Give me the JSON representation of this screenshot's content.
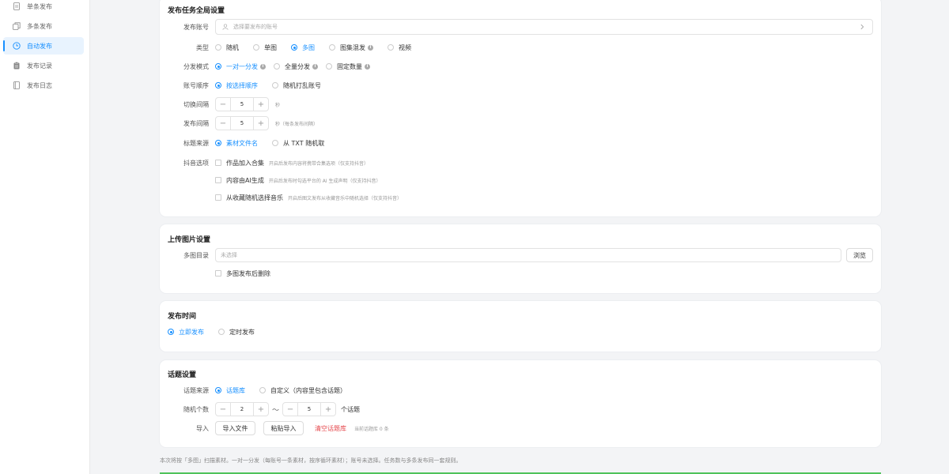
{
  "sidebar": {
    "items": [
      {
        "label": "单条发布",
        "icon": "document-icon"
      },
      {
        "label": "多条发布",
        "icon": "copy-icon"
      },
      {
        "label": "自动发布",
        "icon": "clock-icon",
        "active": true
      },
      {
        "label": "发布记录",
        "icon": "clipboard-icon"
      },
      {
        "label": "发布日志",
        "icon": "notebook-icon"
      }
    ]
  },
  "global": {
    "title": "发布任务全局设置",
    "account": {
      "label": "发布账号",
      "placeholder": "选择要发布的账号"
    },
    "type": {
      "label": "类型",
      "options": [
        "随机",
        "单图",
        "多图",
        "图集混发",
        "视频"
      ],
      "selected": "多图"
    },
    "mode": {
      "label": "分发模式",
      "options": [
        "一对一分发",
        "全量分发",
        "固定数量"
      ],
      "selected": "一对一分发"
    },
    "order": {
      "label": "账号顺序",
      "options": [
        "按选择顺序",
        "随机打乱账号"
      ],
      "selected": "按选择顺序"
    },
    "switch_interval": {
      "label": "切换间隔",
      "value": "5",
      "unit": "秒"
    },
    "publish_interval": {
      "label": "发布间隔",
      "value": "5",
      "unit": "秒（每条发布间隔）"
    },
    "title_source": {
      "label": "标题来源",
      "options": [
        "素材文件名",
        "从 TXT 随机取"
      ],
      "selected": "素材文件名"
    },
    "douyin": {
      "label": "抖音选项",
      "options": [
        {
          "label": "作品加入合集",
          "hint": "开启后发布内容将携带合集选项（仅支持抖音）"
        },
        {
          "label": "内容由AI生成",
          "hint": "开启后发布时勾选平台的 AI 生成声明（仅支持抖音）"
        },
        {
          "label": "从收藏随机选择音乐",
          "hint": "开启后图文发布从收藏音乐中随机选择（仅支持抖音）"
        }
      ]
    }
  },
  "upload": {
    "title": "上传图片设置",
    "dir": {
      "label": "多图目录",
      "placeholder": "未选择",
      "browse": "浏览"
    },
    "delete_after": "多图发布后删除"
  },
  "time": {
    "title": "发布时间",
    "options": [
      "立即发布",
      "定时发布"
    ],
    "selected": "立即发布"
  },
  "topic": {
    "title": "话题设置",
    "source": {
      "label": "话题来源",
      "options": [
        "话题库",
        "自定义（内容里包含话题）"
      ],
      "selected": "话题库"
    },
    "count": {
      "label": "随机个数",
      "min": "2",
      "tilde": "〜",
      "max": "5",
      "unit": "个话题"
    },
    "import": {
      "label": "导入",
      "file_btn": "导入文件",
      "paste_btn": "粘贴导入",
      "clear": "清空话题库",
      "status": "当前话题库 0 条"
    }
  },
  "footer_note": "本次将按「多图」扫描素材。一对一分发（每账号一条素材，按序循环素材）；账号未选择。任务数与多条发布同一套规则。",
  "colors": {
    "accent": "#1890ff",
    "danger": "#e5484d",
    "success": "#4fc35a"
  }
}
